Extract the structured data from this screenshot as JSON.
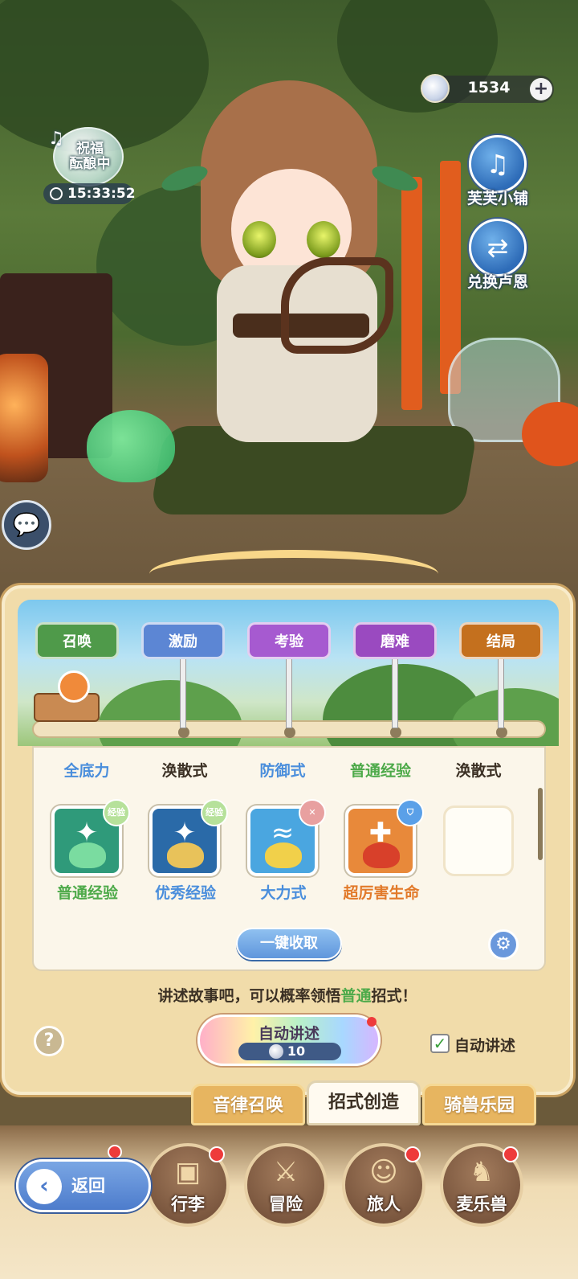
{
  "hud": {
    "currency_value": "1534",
    "currency_plus": "+",
    "brew_label": "祝福\n酝酿中",
    "brew_timer": "15:33:52",
    "shop_label": "芙芙小铺",
    "exchange_label": "兑换卢恩"
  },
  "stages": [
    {
      "label": "召唤",
      "color": "#4f9a4a"
    },
    {
      "label": "激励",
      "color": "#5c86d4"
    },
    {
      "label": "考验",
      "color": "#a65ad0"
    },
    {
      "label": "磨难",
      "color": "#9a4ac0"
    },
    {
      "label": "结局",
      "color": "#c4701e"
    }
  ],
  "columns": [
    {
      "head": "全底力",
      "color": "#4a8edc"
    },
    {
      "head": "涣散式",
      "color": "#3b3024"
    },
    {
      "head": "防御式",
      "color": "#4a8edc"
    },
    {
      "head": "普通经验",
      "color": "#4eaa4a"
    },
    {
      "head": "涣散式",
      "color": "#3b3024"
    }
  ],
  "skills": [
    {
      "name": "普通经验",
      "name_color": "#4eaa4a",
      "badge": "经验",
      "bg": "#2f9a7a",
      "icon": "exp-spirit-icon"
    },
    {
      "name": "优秀经验",
      "name_color": "#4a8edc",
      "badge": "经验",
      "bg": "#2a6aa8",
      "icon": "exp-spirit-icon"
    },
    {
      "name": "大力式",
      "name_color": "#4a8edc",
      "badge": "✕",
      "bg": "#4aa6e0",
      "icon": "power-strike-icon"
    },
    {
      "name": "超厉害生命",
      "name_color": "#e27a2a",
      "badge": "⛉",
      "bg": "#e8893a",
      "icon": "life-shield-icon"
    }
  ],
  "panel": {
    "collect_all": "一键收取",
    "hint_before": "讲述故事吧，可以概率领悟",
    "hint_highlight": "普通",
    "hint_after": "招式！",
    "auto_tell": "自动讲述",
    "auto_cost": "10",
    "auto_checkbox_label": "自动讲述",
    "auto_checked": true
  },
  "subtabs": [
    "音律召唤",
    "招式创造",
    "骑兽乐园"
  ],
  "active_subtab": "招式创造",
  "nav": {
    "back": "返回",
    "items": [
      "行李",
      "冒险",
      "旅人",
      "麦乐兽"
    ]
  }
}
